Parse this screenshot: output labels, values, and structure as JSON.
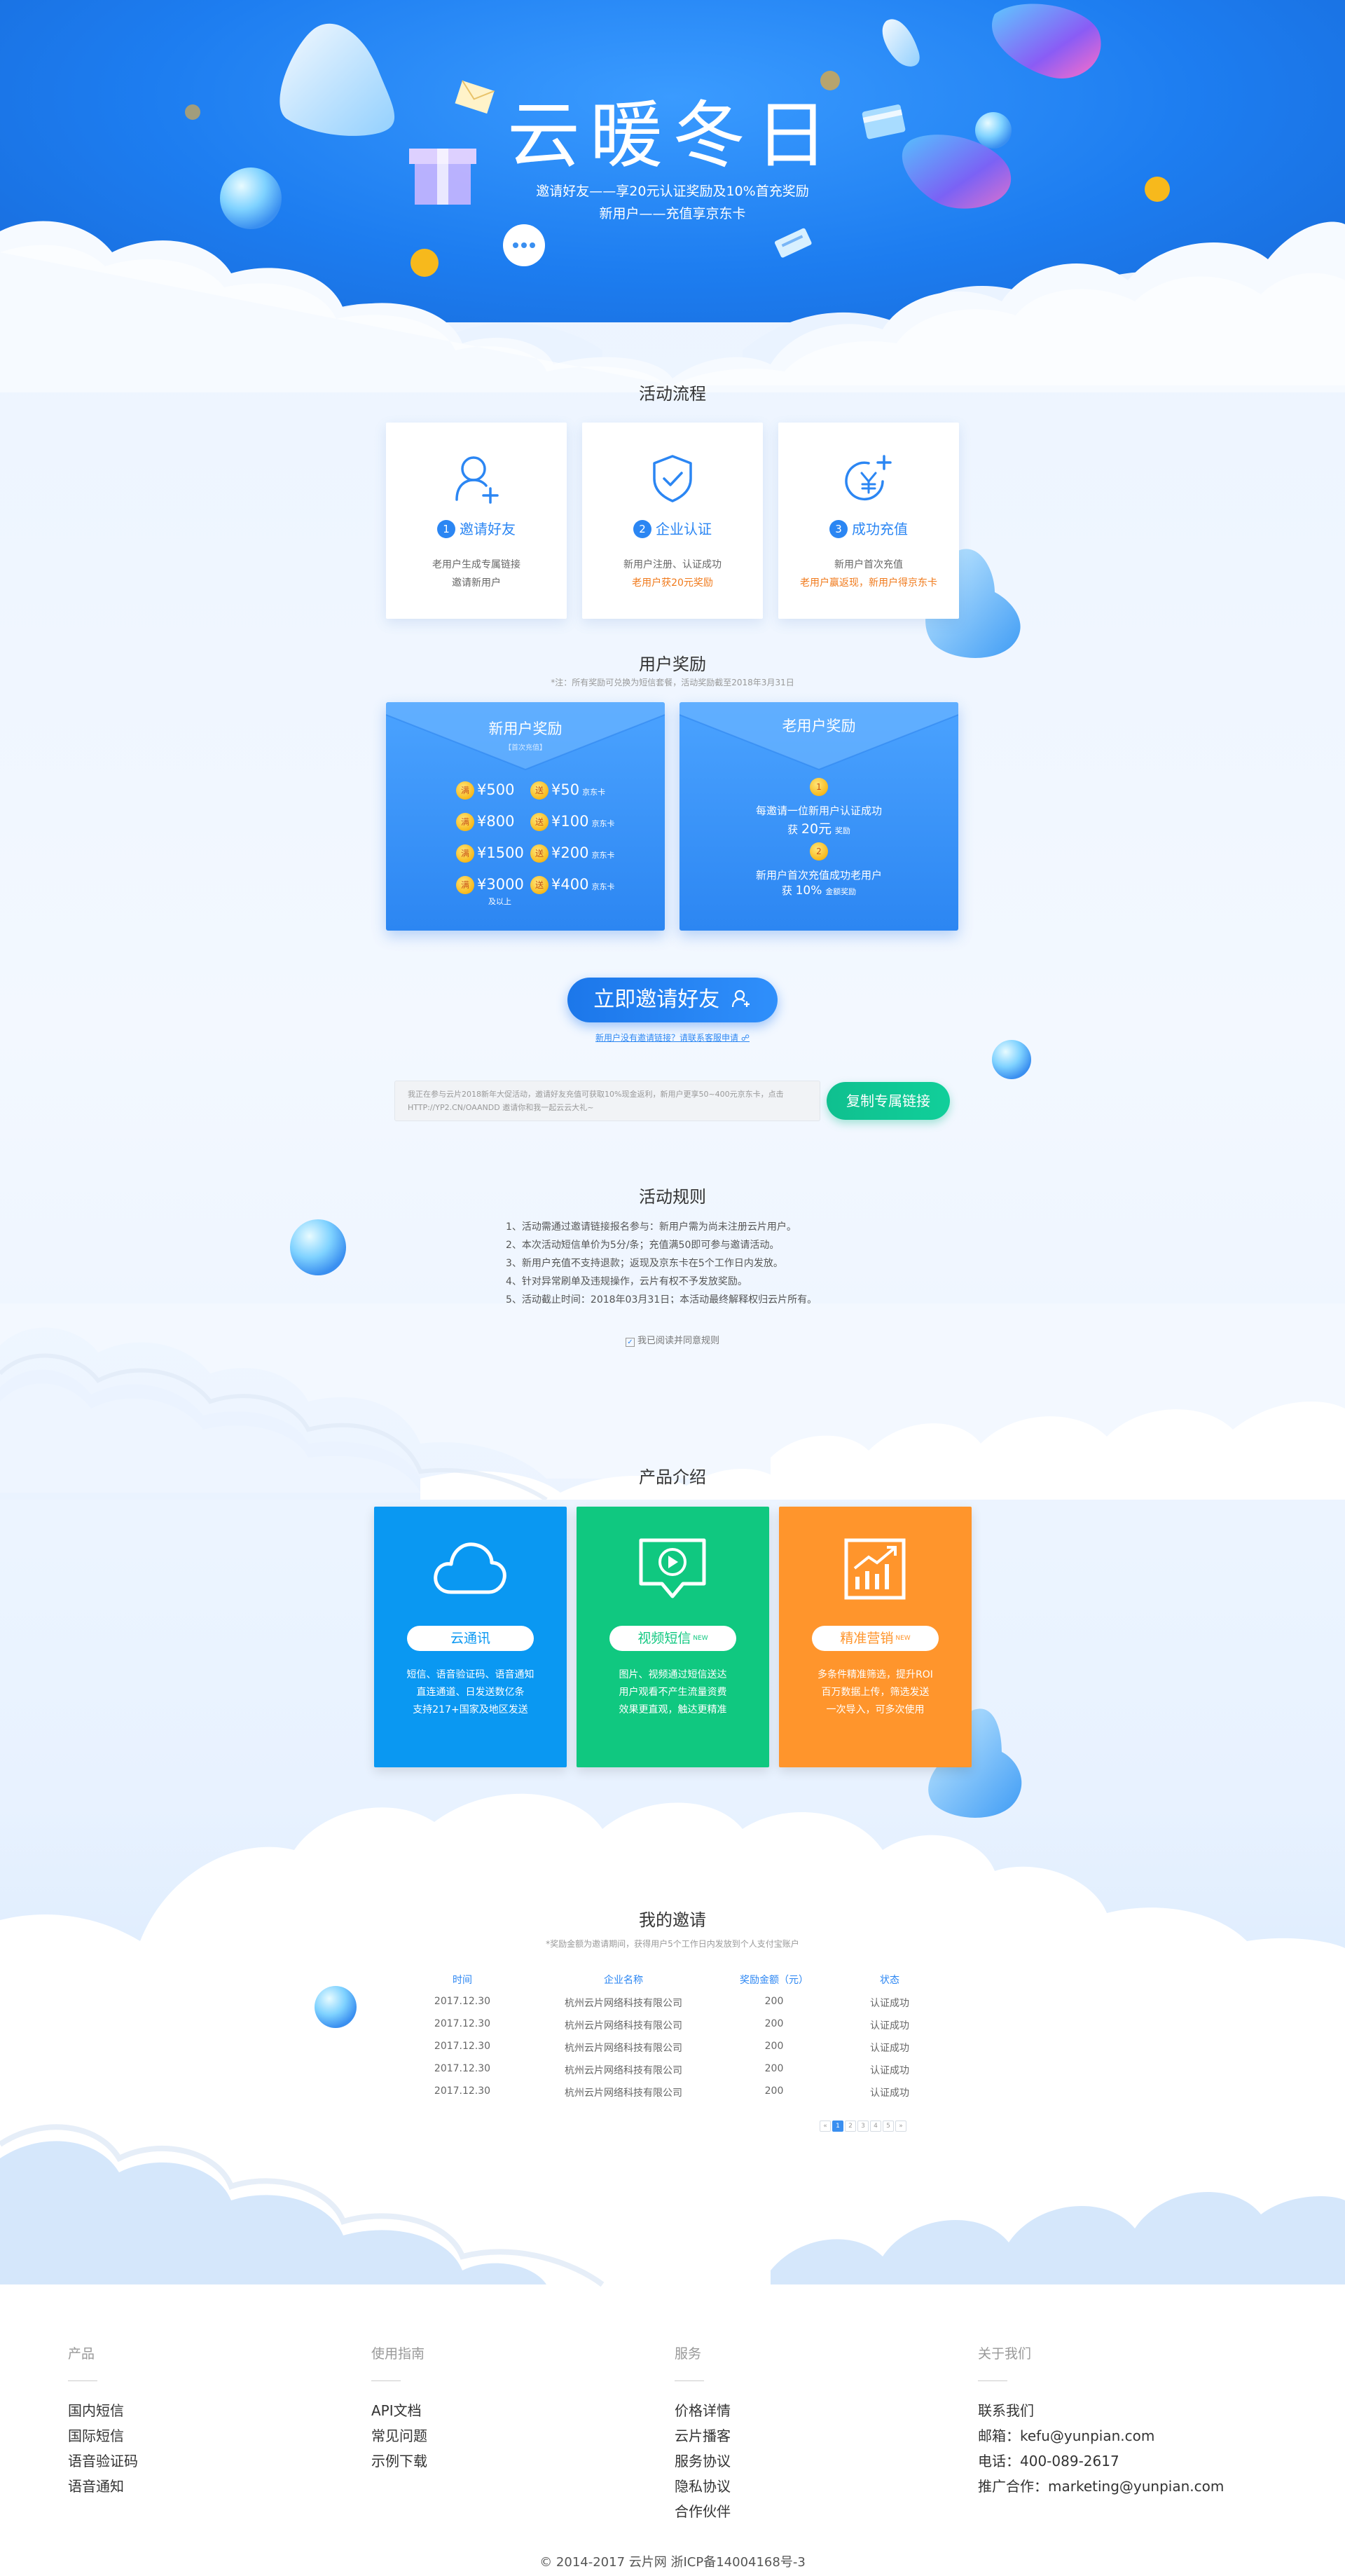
{
  "hero": {
    "title": "云暖冬日",
    "subtitle1": "邀请好友——享20元认证奖励及10%首充奖励",
    "subtitle2": "新用户——充值享京东卡"
  },
  "process": {
    "title": "活动流程",
    "steps": [
      {
        "num": "1",
        "label": "邀请好友",
        "desc1": "老用户生成专属链接",
        "desc2": "邀请新用户"
      },
      {
        "num": "2",
        "label": "企业认证",
        "desc1": "新用户注册、认证成功",
        "desc2": "老用户获20元奖励"
      },
      {
        "num": "3",
        "label": "成功充值",
        "desc1": "新用户首次充值",
        "desc2": "老用户赢返现，新用户得京东卡"
      }
    ]
  },
  "rewards": {
    "title": "用户奖励",
    "note": "*注：所有奖励可兑换为短信套餐，活动奖励截至2018年3月31日",
    "new_user": {
      "title": "新用户奖励",
      "tag": "【首次充值】",
      "coin_label": "满",
      "gift_label": "送",
      "rows": [
        {
          "spend": "¥500",
          "gift": "¥50",
          "unit": "京东卡"
        },
        {
          "spend": "¥800",
          "gift": "¥100",
          "unit": "京东卡"
        },
        {
          "spend": "¥1500",
          "gift": "¥200",
          "unit": "京东卡"
        },
        {
          "spend": "¥3000",
          "gift": "¥400",
          "unit": "京东卡"
        }
      ],
      "above": "及以上"
    },
    "old_user": {
      "title": "老用户奖励",
      "coin1": "1",
      "coin2": "2",
      "line1": "每邀请一位新用户认证成功",
      "line2_prefix": "获",
      "line2_value": "20元",
      "line2_suffix": "奖励",
      "line3": "新用户首次充值成功老用户",
      "line4_prefix": "获",
      "line4_value": "10%",
      "line4_suffix": "金额奖励"
    }
  },
  "invite": {
    "button": "立即邀请好友",
    "link": "新用户没有邀请链接？请联系客服申请",
    "share_text": "我正在参与云片2018新年大促活动，邀请好友充值可获取10%现金返利，新用户更享50~400元京东卡，点击HTTP://YP2.CN/OAANDD 邀请你和我一起云云大礼~",
    "copy_button": "复制专属链接"
  },
  "rules": {
    "title": "活动规则",
    "items": [
      "1、活动需通过邀请链接报名参与：新用户需为尚未注册云片用户。",
      "2、本次活动短信单价为5分/条；充值满50即可参与邀请活动。",
      "3、新用户充值不支持退款；返现及京东卡在5个工作日内发放。",
      "4、针对异常刷单及违规操作，云片有权不予发放奖励。",
      "5、活动截止时间：2018年03月31日；本活动最终解释权归云片所有。"
    ],
    "agree": "我已阅读并同意规则"
  },
  "products": {
    "title": "产品介绍",
    "items": [
      {
        "name": "云通讯",
        "new": "",
        "desc": [
          "短信、语音验证码、语音通知",
          "直连通道、日发送数亿条",
          "支持217+国家及地区发送"
        ],
        "color": "#0a98f2"
      },
      {
        "name": "视频短信",
        "new": "NEW",
        "desc": [
          "图片、视频通过短信送达",
          "用户观看不产生流量资费",
          "效果更直观，触达更精准"
        ],
        "color": "#10c880"
      },
      {
        "name": "精准营销",
        "new": "NEW",
        "desc": [
          "多条件精准筛选，提升ROI",
          "百万数据上传，筛选发送",
          "一次导入，可多次使用"
        ],
        "color": "#ff952c"
      }
    ]
  },
  "invitations": {
    "title": "我的邀请",
    "note": "*奖励金额为邀请期间，获得用户5个工作日内发放到个人支付宝账户",
    "columns": [
      "时间",
      "企业名称",
      "奖励金额（元）",
      "状态"
    ],
    "rows": [
      [
        "2017.12.30",
        "杭州云片网络科技有限公司",
        "200",
        "认证成功"
      ],
      [
        "2017.12.30",
        "杭州云片网络科技有限公司",
        "200",
        "认证成功"
      ],
      [
        "2017.12.30",
        "杭州云片网络科技有限公司",
        "200",
        "认证成功"
      ],
      [
        "2017.12.30",
        "杭州云片网络科技有限公司",
        "200",
        "认证成功"
      ],
      [
        "2017.12.30",
        "杭州云片网络科技有限公司",
        "200",
        "认证成功"
      ]
    ],
    "pagination": [
      "«",
      "1",
      "2",
      "3",
      "4",
      "5",
      "»"
    ]
  },
  "footer": {
    "columns": [
      {
        "title": "产品",
        "items": [
          "国内短信",
          "国际短信",
          "语音验证码",
          "语音通知"
        ]
      },
      {
        "title": "使用指南",
        "items": [
          "API文档",
          "常见问题",
          "示例下载"
        ]
      },
      {
        "title": "服务",
        "items": [
          "价格详情",
          "云片播客",
          "服务协议",
          "隐私协议",
          "合作伙伴"
        ]
      },
      {
        "title": "关于我们",
        "items": [
          "联系我们",
          "邮箱：kefu@yunpian.com",
          "电话：400-089-2617",
          "推广合作：marketing@yunpian.com"
        ]
      }
    ],
    "copyright": "© 2014-2017 云片网 浙ICP备14004168号-3"
  },
  "colors": {
    "primary": "#2b86f3",
    "highlight": "#f07a1c",
    "green": "#10c880",
    "orange": "#ff952c",
    "sky": "#0a98f2"
  }
}
